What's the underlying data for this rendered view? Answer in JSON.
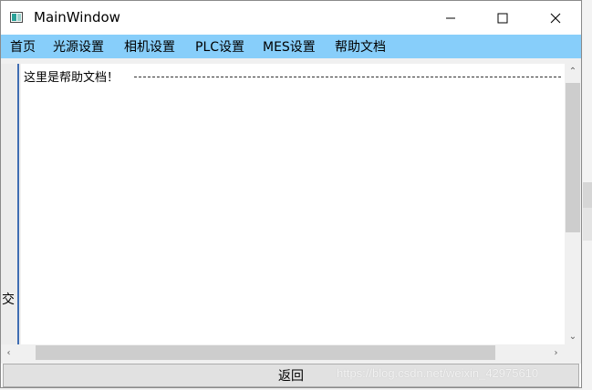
{
  "window": {
    "title": "MainWindow"
  },
  "menu": {
    "items": [
      {
        "label": "首页"
      },
      {
        "label": "光源设置"
      },
      {
        "label": "相机设置"
      },
      {
        "label": "PLC设置"
      },
      {
        "label": "MES设置"
      },
      {
        "label": "帮助文档"
      }
    ]
  },
  "side_panel": {
    "label": "交"
  },
  "document": {
    "text": "这里是帮助文档！"
  },
  "footer": {
    "back_label": "返回"
  },
  "watermark": {
    "text": "https://blog.csdn.net/weixin_42975610"
  },
  "colors": {
    "menubar": "#87cefa",
    "accent_border": "#3f6db3",
    "button": "#e1e1e1"
  }
}
